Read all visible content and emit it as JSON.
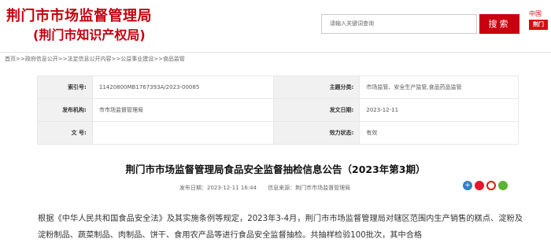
{
  "header": {
    "title": "荆门市市场监督管理局",
    "subtitle": "(荆门市知识产权局)",
    "search_placeholder": "请输入关键词查询",
    "search_button": "搜索",
    "logo_top": "中国",
    "logo_badge": "荆门",
    "brand_color": "#c4000e"
  },
  "breadcrumb": {
    "items": [
      "首页",
      "政府信息公开",
      "法定信息公开内容",
      "公益事业建设",
      "食品监管"
    ],
    "separator": ">>"
  },
  "info": {
    "index_label": "索引号:",
    "index_value": "11420800MB1767393A/2023-00085",
    "topic_label": "主题分类:",
    "topic_value": "市场监管、安全生产监管,食品药品监管",
    "publisher_label": "发布机构:",
    "publisher_value": "市市场监督管理局",
    "date_label": "发文日期:",
    "date_value": "2023-12-11",
    "docno_label": "文 号:",
    "docno_value": "",
    "validity_label": "效力状态:",
    "validity_value": "有效"
  },
  "article": {
    "title": "荆门市市场监督管理局食品安全监督抽检信息公告（2023年第3期）",
    "publish_time": "发布日期：2023-12-11 16:44",
    "source": "信息来源：荆门市市场监督管理局",
    "body": "根据《中华人民共和国食品安全法》及其实施条例等规定，2023年3-4月，荆门市市场监督管理局对辖区范围内生产销售的糕点、淀粉及淀粉制品、蔬菜制品、肉制品、饼干、食用农产品等进行食品安全监督抽检。共抽样检验100批次，其中合格"
  },
  "share_icons": [
    "share-plus-icon",
    "weibo-icon",
    "people-icon",
    "wechat-icon"
  ]
}
